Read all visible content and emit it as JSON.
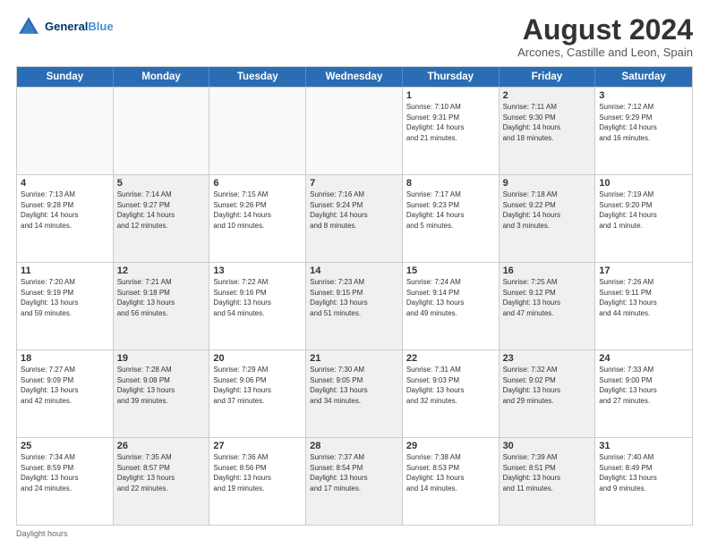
{
  "header": {
    "logo_line1": "General",
    "logo_line2": "Blue",
    "month": "August 2024",
    "location": "Arcones, Castille and Leon, Spain"
  },
  "days": [
    "Sunday",
    "Monday",
    "Tuesday",
    "Wednesday",
    "Thursday",
    "Friday",
    "Saturday"
  ],
  "footer": "Daylight hours",
  "weeks": [
    [
      {
        "num": "",
        "info": "",
        "empty": true
      },
      {
        "num": "",
        "info": "",
        "empty": true
      },
      {
        "num": "",
        "info": "",
        "empty": true
      },
      {
        "num": "",
        "info": "",
        "empty": true
      },
      {
        "num": "1",
        "info": "Sunrise: 7:10 AM\nSunset: 9:31 PM\nDaylight: 14 hours\nand 21 minutes."
      },
      {
        "num": "2",
        "info": "Sunrise: 7:11 AM\nSunset: 9:30 PM\nDaylight: 14 hours\nand 18 minutes.",
        "shaded": true
      },
      {
        "num": "3",
        "info": "Sunrise: 7:12 AM\nSunset: 9:29 PM\nDaylight: 14 hours\nand 16 minutes."
      }
    ],
    [
      {
        "num": "4",
        "info": "Sunrise: 7:13 AM\nSunset: 9:28 PM\nDaylight: 14 hours\nand 14 minutes."
      },
      {
        "num": "5",
        "info": "Sunrise: 7:14 AM\nSunset: 9:27 PM\nDaylight: 14 hours\nand 12 minutes.",
        "shaded": true
      },
      {
        "num": "6",
        "info": "Sunrise: 7:15 AM\nSunset: 9:26 PM\nDaylight: 14 hours\nand 10 minutes."
      },
      {
        "num": "7",
        "info": "Sunrise: 7:16 AM\nSunset: 9:24 PM\nDaylight: 14 hours\nand 8 minutes.",
        "shaded": true
      },
      {
        "num": "8",
        "info": "Sunrise: 7:17 AM\nSunset: 9:23 PM\nDaylight: 14 hours\nand 5 minutes."
      },
      {
        "num": "9",
        "info": "Sunrise: 7:18 AM\nSunset: 9:22 PM\nDaylight: 14 hours\nand 3 minutes.",
        "shaded": true
      },
      {
        "num": "10",
        "info": "Sunrise: 7:19 AM\nSunset: 9:20 PM\nDaylight: 14 hours\nand 1 minute."
      }
    ],
    [
      {
        "num": "11",
        "info": "Sunrise: 7:20 AM\nSunset: 9:19 PM\nDaylight: 13 hours\nand 59 minutes."
      },
      {
        "num": "12",
        "info": "Sunrise: 7:21 AM\nSunset: 9:18 PM\nDaylight: 13 hours\nand 56 minutes.",
        "shaded": true
      },
      {
        "num": "13",
        "info": "Sunrise: 7:22 AM\nSunset: 9:16 PM\nDaylight: 13 hours\nand 54 minutes."
      },
      {
        "num": "14",
        "info": "Sunrise: 7:23 AM\nSunset: 9:15 PM\nDaylight: 13 hours\nand 51 minutes.",
        "shaded": true
      },
      {
        "num": "15",
        "info": "Sunrise: 7:24 AM\nSunset: 9:14 PM\nDaylight: 13 hours\nand 49 minutes."
      },
      {
        "num": "16",
        "info": "Sunrise: 7:25 AM\nSunset: 9:12 PM\nDaylight: 13 hours\nand 47 minutes.",
        "shaded": true
      },
      {
        "num": "17",
        "info": "Sunrise: 7:26 AM\nSunset: 9:11 PM\nDaylight: 13 hours\nand 44 minutes."
      }
    ],
    [
      {
        "num": "18",
        "info": "Sunrise: 7:27 AM\nSunset: 9:09 PM\nDaylight: 13 hours\nand 42 minutes."
      },
      {
        "num": "19",
        "info": "Sunrise: 7:28 AM\nSunset: 9:08 PM\nDaylight: 13 hours\nand 39 minutes.",
        "shaded": true
      },
      {
        "num": "20",
        "info": "Sunrise: 7:29 AM\nSunset: 9:06 PM\nDaylight: 13 hours\nand 37 minutes."
      },
      {
        "num": "21",
        "info": "Sunrise: 7:30 AM\nSunset: 9:05 PM\nDaylight: 13 hours\nand 34 minutes.",
        "shaded": true
      },
      {
        "num": "22",
        "info": "Sunrise: 7:31 AM\nSunset: 9:03 PM\nDaylight: 13 hours\nand 32 minutes."
      },
      {
        "num": "23",
        "info": "Sunrise: 7:32 AM\nSunset: 9:02 PM\nDaylight: 13 hours\nand 29 minutes.",
        "shaded": true
      },
      {
        "num": "24",
        "info": "Sunrise: 7:33 AM\nSunset: 9:00 PM\nDaylight: 13 hours\nand 27 minutes."
      }
    ],
    [
      {
        "num": "25",
        "info": "Sunrise: 7:34 AM\nSunset: 8:59 PM\nDaylight: 13 hours\nand 24 minutes."
      },
      {
        "num": "26",
        "info": "Sunrise: 7:35 AM\nSunset: 8:57 PM\nDaylight: 13 hours\nand 22 minutes.",
        "shaded": true
      },
      {
        "num": "27",
        "info": "Sunrise: 7:36 AM\nSunset: 8:56 PM\nDaylight: 13 hours\nand 19 minutes."
      },
      {
        "num": "28",
        "info": "Sunrise: 7:37 AM\nSunset: 8:54 PM\nDaylight: 13 hours\nand 17 minutes.",
        "shaded": true
      },
      {
        "num": "29",
        "info": "Sunrise: 7:38 AM\nSunset: 8:53 PM\nDaylight: 13 hours\nand 14 minutes."
      },
      {
        "num": "30",
        "info": "Sunrise: 7:39 AM\nSunset: 8:51 PM\nDaylight: 13 hours\nand 11 minutes.",
        "shaded": true
      },
      {
        "num": "31",
        "info": "Sunrise: 7:40 AM\nSunset: 8:49 PM\nDaylight: 13 hours\nand 9 minutes."
      }
    ]
  ]
}
